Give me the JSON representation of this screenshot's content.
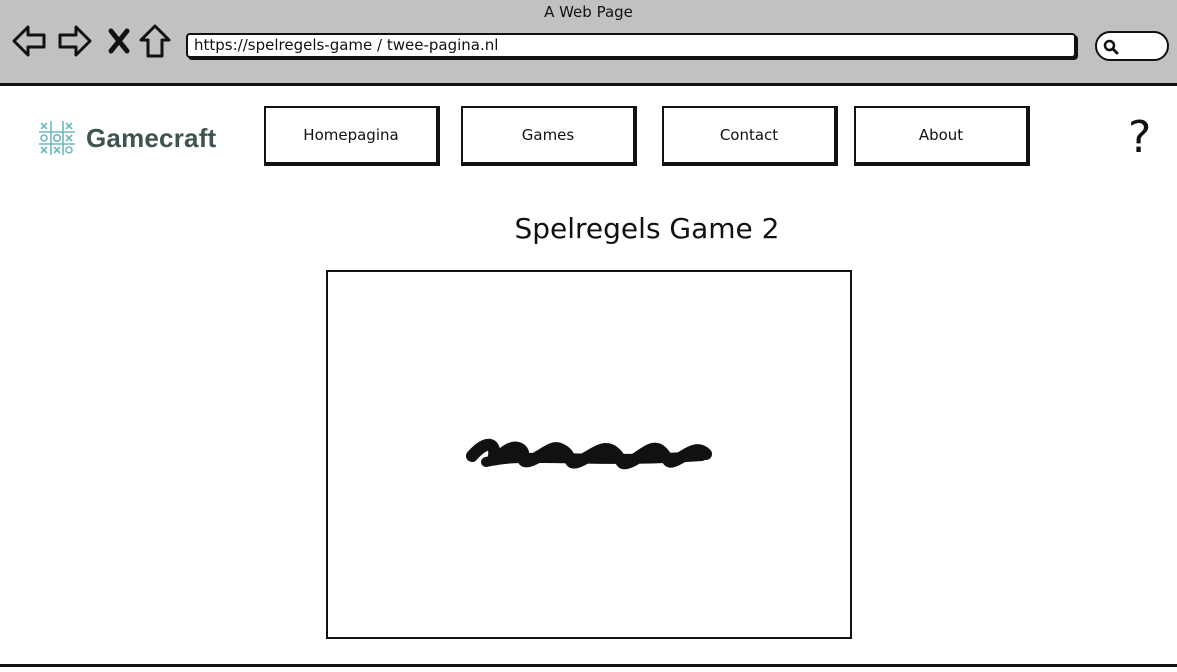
{
  "window": {
    "title": "A Web Page"
  },
  "browser": {
    "url": "https://spelregels-game / twee-pagina.nl",
    "buttons": {
      "back": "back-arrow-icon",
      "forward": "forward-arrow-icon",
      "close": "close-icon",
      "home": "home-icon",
      "search": "search-icon"
    }
  },
  "header": {
    "logo_text": "Gamecraft",
    "logo_icon": "tic-tac-toe-icon",
    "logo_color": "#3d5450",
    "logo_icon_color": "#6fb8c0",
    "help_label": "?"
  },
  "nav": {
    "items": [
      {
        "label": "Homepagina"
      },
      {
        "label": "Games"
      },
      {
        "label": "Contact"
      },
      {
        "label": "About"
      }
    ]
  },
  "main": {
    "title": "Spelregels Game 2",
    "placeholder_icon": "scribbled-text-placeholder"
  }
}
